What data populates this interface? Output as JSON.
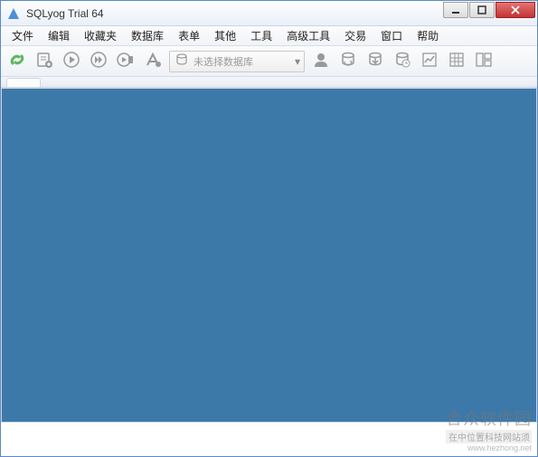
{
  "window": {
    "title": "SQLyog Trial 64"
  },
  "menubar": {
    "items": [
      "文件",
      "编辑",
      "收藏夹",
      "数据库",
      "表单",
      "其他",
      "工具",
      "高级工具",
      "交易",
      "窗口",
      "帮助"
    ]
  },
  "toolbar": {
    "connect_icon": "connect-icon",
    "new_query_icon": "new-query-icon",
    "execute_icon": "execute-icon",
    "execute_all_icon": "execute-all-icon",
    "execute_explain_icon": "execute-explain-icon",
    "format_icon": "format-icon",
    "db_selector_placeholder": "未选择数据库",
    "user_icon": "user-icon",
    "sync_icon": "sync-icon",
    "backup_icon": "backup-icon",
    "schedule_icon": "schedule-icon",
    "chart_icon": "chart-icon",
    "grid_icon": "grid-icon",
    "layout_icon": "layout-icon"
  },
  "watermark": {
    "line1": "合众软件园",
    "line2": "在中位置科技网站须",
    "line3": "www.hezhong.net"
  },
  "colors": {
    "content_bg": "#3d79a8",
    "accent_green": "#5cb85c"
  }
}
